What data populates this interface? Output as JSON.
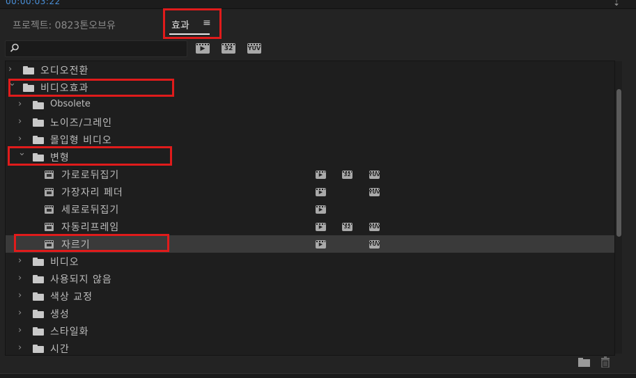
{
  "top": {
    "timecode": "00:00:03:22",
    "corner_icon": "⇣"
  },
  "header": {
    "project_tab": "프로젝트: 0823톤오브유",
    "effects_tab": "효과",
    "menu_icon": "≡"
  },
  "search": {
    "value": "",
    "placeholder": ""
  },
  "toolbar": {
    "badges": [
      {
        "name": "accelerated-effects-filter",
        "text": "▶"
      },
      {
        "name": "32bit-filter",
        "text": "32"
      },
      {
        "name": "yuv-filter",
        "text": "YUV"
      }
    ]
  },
  "tree": [
    {
      "label": "오디오전환",
      "level": 0,
      "type": "folder",
      "expanded": false
    },
    {
      "label": "비디오효과",
      "level": 0,
      "type": "folder",
      "expanded": true
    },
    {
      "label": "Obsolete",
      "level": 1,
      "type": "folder",
      "expanded": false
    },
    {
      "label": "노이즈/그레인",
      "level": 1,
      "type": "folder",
      "expanded": false
    },
    {
      "label": "몰입형 비디오",
      "level": 1,
      "type": "folder",
      "expanded": false
    },
    {
      "label": "변형",
      "level": 1,
      "type": "folder",
      "expanded": true
    },
    {
      "label": "가로로뒤집기",
      "level": 2,
      "type": "effect",
      "accel": true,
      "bit32": true,
      "yuv": true
    },
    {
      "label": "가장자리 페더",
      "level": 2,
      "type": "effect",
      "accel": true,
      "bit32": false,
      "yuv": true
    },
    {
      "label": "세로로뒤집기",
      "level": 2,
      "type": "effect",
      "accel": true,
      "bit32": false,
      "yuv": false
    },
    {
      "label": "자동리프레임",
      "level": 2,
      "type": "effect",
      "accel": true,
      "bit32": true,
      "yuv": true
    },
    {
      "label": "자르기",
      "level": 2,
      "type": "effect",
      "accel": true,
      "bit32": false,
      "yuv": true,
      "selected": true
    },
    {
      "label": "비디오",
      "level": 1,
      "type": "folder",
      "expanded": false
    },
    {
      "label": "사용되지 않음",
      "level": 1,
      "type": "folder",
      "expanded": false
    },
    {
      "label": "색상 교정",
      "level": 1,
      "type": "folder",
      "expanded": false
    },
    {
      "label": "생성",
      "level": 1,
      "type": "folder",
      "expanded": false
    },
    {
      "label": "스타일화",
      "level": 1,
      "type": "folder",
      "expanded": false
    },
    {
      "label": "시간",
      "level": 1,
      "type": "folder",
      "expanded": false
    }
  ],
  "badge_text": {
    "accel": "▶",
    "bit32": "32",
    "yuv": "YUV"
  },
  "footer": {
    "new_bin_icon": "new-bin-icon",
    "trash_icon": "trash-icon"
  },
  "colors": {
    "highlight": "#e01b1b",
    "timecode": "#4a90d9",
    "selected_row": "#3a3a3a"
  }
}
